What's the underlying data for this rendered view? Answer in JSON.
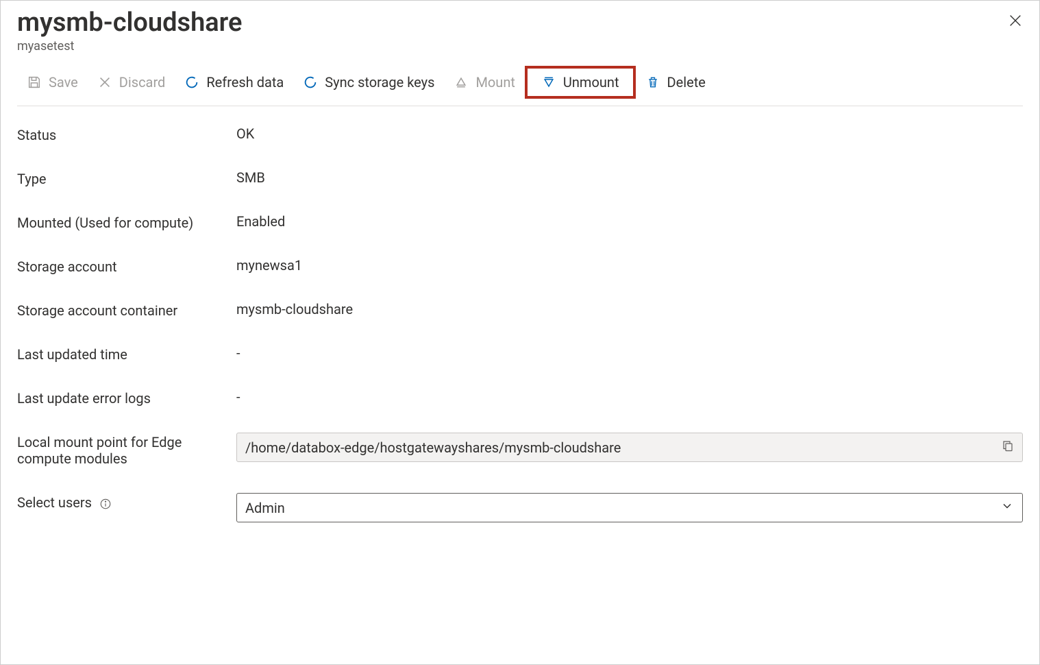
{
  "header": {
    "title": "mysmb-cloudshare",
    "subtitle": "myasetest"
  },
  "toolbar": {
    "save": "Save",
    "discard": "Discard",
    "refresh": "Refresh data",
    "sync": "Sync storage keys",
    "mount": "Mount",
    "unmount": "Unmount",
    "delete": "Delete"
  },
  "labels": {
    "status": "Status",
    "type": "Type",
    "mounted": "Mounted (Used for compute)",
    "storage_account": "Storage account",
    "container": "Storage account container",
    "last_updated": "Last updated time",
    "error_logs": "Last update error logs",
    "mount_point": "Local mount point for Edge compute modules",
    "select_users": "Select users"
  },
  "values": {
    "status": "OK",
    "type": "SMB",
    "mounted": "Enabled",
    "storage_account": "mynewsa1",
    "container": "mysmb-cloudshare",
    "last_updated": "-",
    "error_logs": "-",
    "mount_point": "/home/databox-edge/hostgatewayshares/mysmb-cloudshare",
    "select_users": "Admin"
  }
}
